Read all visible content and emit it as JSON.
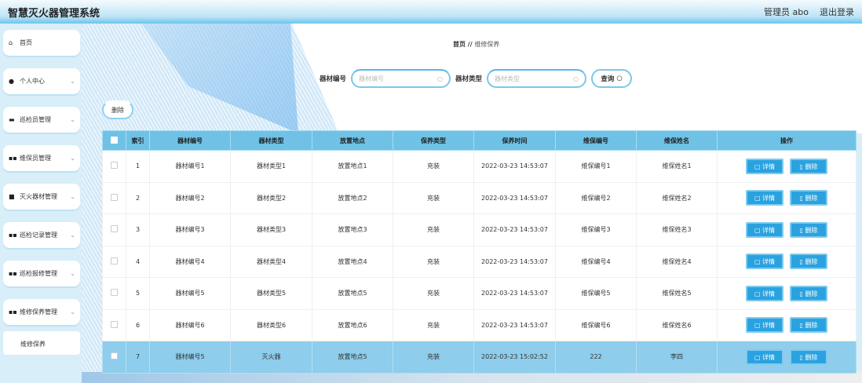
{
  "header": {
    "title": "智慧灭火器管理系统",
    "user": "管理员 abo",
    "logout": "退出登录"
  },
  "sidebar": {
    "items": [
      {
        "label": "首页",
        "icon": "home-icon",
        "chevron": false
      },
      {
        "label": "个人中心",
        "icon": "user-icon",
        "chevron": true
      },
      {
        "label": "巡检员管理",
        "icon": "briefcase-icon",
        "chevron": true
      },
      {
        "label": "维保员管理",
        "icon": "grid-icon",
        "chevron": true
      },
      {
        "label": "灭火器材管理",
        "icon": "device-icon",
        "chevron": true
      },
      {
        "label": "巡检记录管理",
        "icon": "grid-icon",
        "chevron": true
      },
      {
        "label": "巡检报修管理",
        "icon": "grid-icon",
        "chevron": true
      },
      {
        "label": "维修保养管理",
        "icon": "grid-icon",
        "chevron": true
      }
    ],
    "sub_item": "维修保养"
  },
  "breadcrumb": {
    "home": "首页",
    "sep": "//",
    "current": "维修保养"
  },
  "search": {
    "label1": "器材编号",
    "placeholder1": "器材编号",
    "label2": "器材类型",
    "placeholder2": "器材类型",
    "query": "查询"
  },
  "toolbar": {
    "delete": "删除"
  },
  "table": {
    "headers": [
      "索引",
      "器材编号",
      "器材类型",
      "放置地点",
      "保养类型",
      "保养时间",
      "维保编号",
      "维保姓名",
      "操作"
    ],
    "detail": "详情",
    "delete": "删除",
    "rows": [
      [
        "1",
        "器材编号1",
        "器材类型1",
        "放置地点1",
        "充装",
        "2022-03-23 14:53:07",
        "维保编号1",
        "维保姓名1"
      ],
      [
        "2",
        "器材编号2",
        "器材类型2",
        "放置地点2",
        "充装",
        "2022-03-23 14:53:07",
        "维保编号2",
        "维保姓名2"
      ],
      [
        "3",
        "器材编号3",
        "器材类型3",
        "放置地点3",
        "充装",
        "2022-03-23 14:53:07",
        "维保编号3",
        "维保姓名3"
      ],
      [
        "4",
        "器材编号4",
        "器材类型4",
        "放置地点4",
        "充装",
        "2022-03-23 14:53:07",
        "维保编号4",
        "维保姓名4"
      ],
      [
        "5",
        "器材编号5",
        "器材类型5",
        "放置地点5",
        "充装",
        "2022-03-23 14:53:07",
        "维保编号5",
        "维保姓名5"
      ],
      [
        "6",
        "器材编号6",
        "器材类型6",
        "放置地点6",
        "充装",
        "2022-03-23 14:53:07",
        "维保编号6",
        "维保姓名6"
      ],
      [
        "7",
        "器材编号5",
        "灭火器",
        "放置地点5",
        "充装",
        "2022-03-23 15:02:52",
        "222",
        "李四"
      ]
    ]
  }
}
